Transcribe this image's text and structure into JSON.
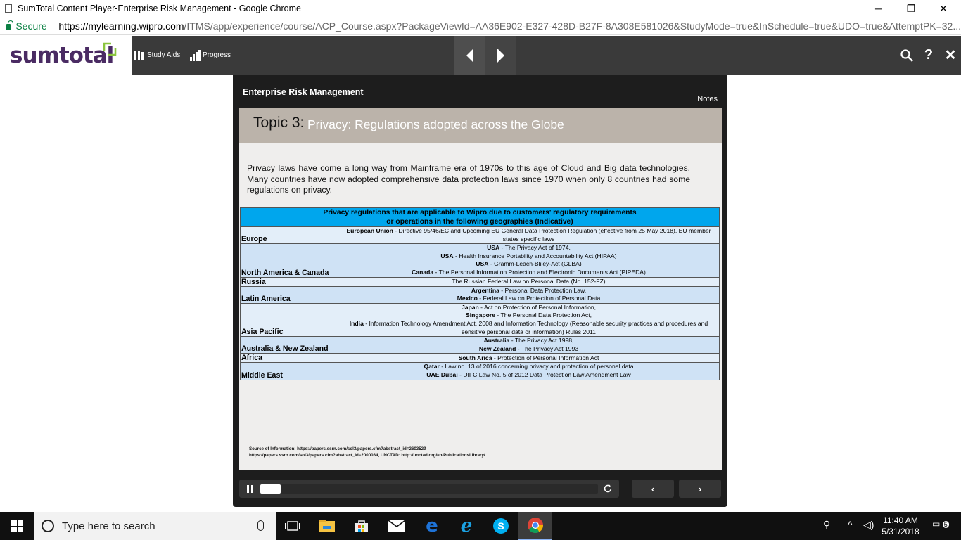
{
  "window": {
    "title": "SumTotal Content Player-Enterprise Risk Management - Google Chrome",
    "minimize": "─",
    "restore": "❐",
    "close": "✕"
  },
  "address": {
    "secure_label": "Secure",
    "url_host": "https://mylearning.wipro.com",
    "url_path": "/ITMS/app/experience/course/ACP_Course.aspx?PackageViewId=AA36E902-E327-428D-B27F-8A308E581026&StudyMode=true&InSchedule=true&UDO=true&AttemptPK=32..."
  },
  "app": {
    "logo": "sumtotal",
    "study_aids": "Study Aids",
    "progress": "Progress",
    "icons": [
      "search-icon",
      "help-icon",
      "close-icon"
    ]
  },
  "player": {
    "course_title": "Enterprise Risk Management",
    "notes": "Notes",
    "progress_fraction": 0.06
  },
  "slide": {
    "topic_number": "Topic 3:",
    "topic_title": "Privacy: Regulations adopted across the Globe",
    "intro": "Privacy laws have come a long way from Mainframe era of 1970s to this age of Cloud and Big data technologies. Many countries have now adopted comprehensive data protection laws since 1970 when only 8 countries had some regulations on privacy.",
    "table_header_line1": "Privacy regulations that are applicable to Wipro due to customers' regulatory requirements",
    "table_header_line2": "or operations in the following geographies (Indicative)",
    "rows": [
      {
        "region": "Europe",
        "laws": [
          {
            "country": "European Union",
            "text": " - Directive 95/46/EC and Upcoming EU General Data Protection Regulation (effective from 25 May 2018), EU member states specific laws"
          }
        ]
      },
      {
        "region": "North America & Canada",
        "laws": [
          {
            "country": "USA",
            "text": " - The Privacy Act of 1974,"
          },
          {
            "country": "USA",
            "text": " - Health Insurance Portability and Accountability Act (HIPAA)"
          },
          {
            "country": "USA",
            "text": " - Gramm-Leach-Bliley-Act (GLBA)"
          },
          {
            "country": "Canada",
            "text": " - The Personal Information Protection and Electronic Documents Act (PIPEDA)"
          }
        ]
      },
      {
        "region": "Russia",
        "laws": [
          {
            "country": "",
            "text": "The Russian Federal Law on Personal Data (No. 152-FZ)"
          }
        ]
      },
      {
        "region": "Latin America",
        "laws": [
          {
            "country": "Argentina",
            "text": " - Personal Data Protection Law,"
          },
          {
            "country": "Mexico",
            "text": " - Federal Law on Protection of Personal Data"
          }
        ]
      },
      {
        "region": "Asia Pacific",
        "laws": [
          {
            "country": "Japan",
            "text": " - Act on Protection of Personal Information,"
          },
          {
            "country": "Singapore",
            "text": " - The Personal Data Protection Act,"
          },
          {
            "country": "India",
            "text": " - Information Technology Amendment Act, 2008 and Information Technology (Reasonable security practices and procedures and sensitive personal data or information) Rules 2011"
          }
        ]
      },
      {
        "region": "Australia & New Zealand",
        "laws": [
          {
            "country": "Australia",
            "text": " - The Privacy Act 1998,"
          },
          {
            "country": "New Zealand",
            "text": " - The Privacy Act 1993"
          }
        ]
      },
      {
        "region": "Africa",
        "laws": [
          {
            "country": "South Arica",
            "text": " - Protection of Personal Information Act"
          }
        ]
      },
      {
        "region": "Middle East",
        "laws": [
          {
            "country": "Qatar",
            "text": " - Law no. 13 of 2016 concerning privacy and protection of personal data"
          },
          {
            "country": "UAE Dubai",
            "text": " - DIFC Law No. 5 of 2012 Data Protection Law Amendment Law"
          }
        ]
      }
    ],
    "source_line1": "Source of Information: https://papers.ssrn.com/sol3/papers.cfm?abstract_id=2603529",
    "source_line2": "https://papers.ssrn.com/sol3/papers.cfm?abstract_id=2000034, UNCTAD: http://unctad.org/en/PublicationsLibrary/"
  },
  "taskbar": {
    "search_placeholder": "Type here to search",
    "time": "11:40 AM",
    "date": "5/31/2018",
    "notification_count": "5",
    "colors": {
      "edge": "#1e73d8",
      "ie": "#1ba1e2",
      "skype": "#00aff0",
      "explorer": "#f5c342"
    }
  }
}
